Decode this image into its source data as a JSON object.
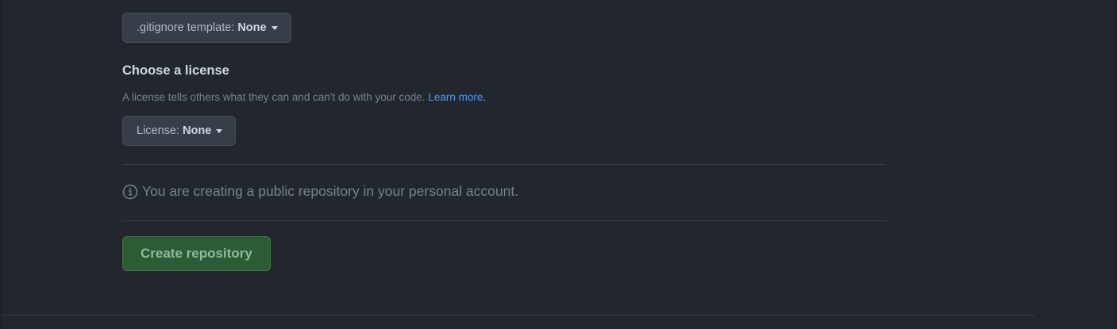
{
  "gitignore": {
    "label": ".gitignore template:",
    "value": "None"
  },
  "license_section": {
    "heading": "Choose a license",
    "description": "A license tells others what they can and can't do with your code.",
    "learn_more": "Learn more.",
    "select_label": "License:",
    "select_value": "None"
  },
  "notice": {
    "text": "You are creating a public repository in your personal account."
  },
  "actions": {
    "create_label": "Create repository"
  },
  "colors": {
    "background": "#22272e",
    "link": "#539bf5",
    "create_button_bg": "#2b5c36"
  },
  "icons": {
    "caret": "caret-down-icon",
    "info": "info-icon"
  }
}
